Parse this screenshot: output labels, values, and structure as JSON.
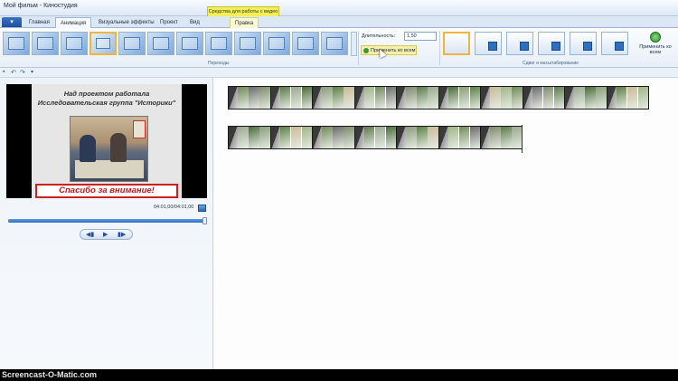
{
  "window": {
    "title": "Мой фильм - Киностудия"
  },
  "context_tab_header": "Средства для работы с видео",
  "tabs": [
    {
      "label": "Главная",
      "active": false
    },
    {
      "label": "Анимация",
      "active": true
    },
    {
      "label": "Визуальные эффекты",
      "active": false
    },
    {
      "label": "Проект",
      "active": false
    },
    {
      "label": "Вид",
      "active": false
    },
    {
      "label": "Правка",
      "active": false,
      "contextual": true
    }
  ],
  "file_button_icon": "file-menu-icon",
  "ribbon": {
    "transitions_group_label": "Переходы",
    "pan_zoom_group_label": "Сдвиг и масштабирование",
    "duration_label": "Длительность:",
    "duration_value": "1,50",
    "apply_to_all_small": "Применить ко всем",
    "apply_to_all_big": "Применить ко всем",
    "transition_count": 12,
    "pan_count": 6
  },
  "preview": {
    "slide_title": "Над проектом работала Исследовательская группа \"Историки\"",
    "slide_banner": "Спасибо за внимание!",
    "timecode": "04:01,00/04:01,00",
    "progress": 1.0
  },
  "storyboard": {
    "row1_clip_count": 10,
    "row2_clip_count": 7,
    "colors": [
      "#6b6b6b",
      "#7d8a6a",
      "#5c7a4a",
      "#9aa890",
      "#4a6a3a",
      "#8a9c7a",
      "#5e7f48",
      "#c9b99a",
      "#a0b48a",
      "#6f8a5a"
    ]
  },
  "watermark": "Screencast-O-Matic.com",
  "accent_color": "#2d6fbe"
}
